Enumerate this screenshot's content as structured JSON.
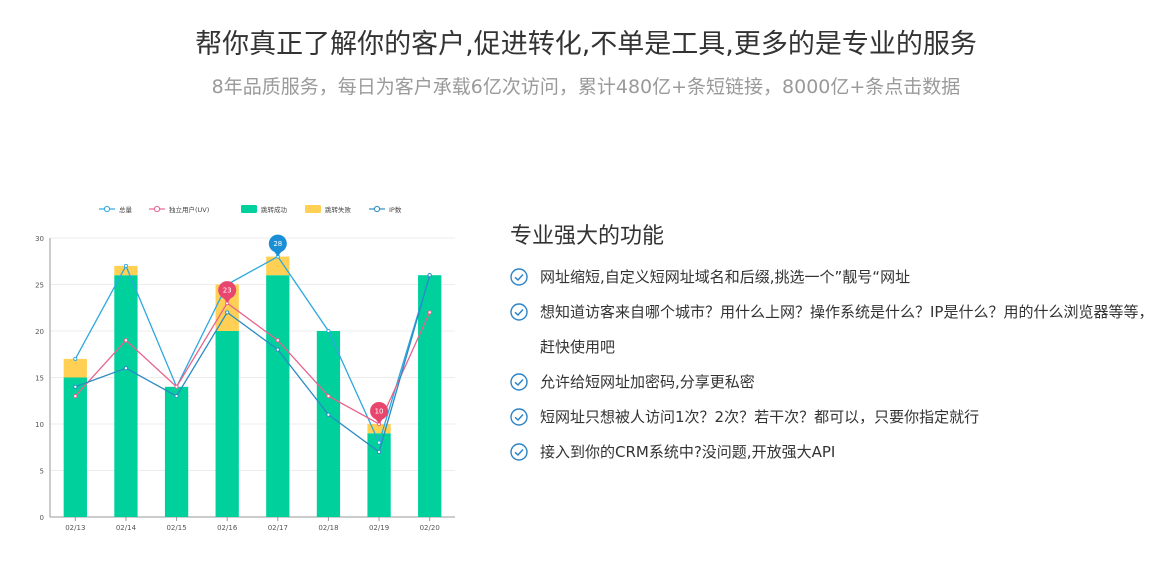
{
  "header": {
    "title": "帮你真正了解你的客户,促进转化,不单是工具,更多的是专业的服务",
    "subtitle": "8年品质服务，每日为客户承载6亿次访问，累计480亿+条短链接，8000亿+条点击数据"
  },
  "features": {
    "title": "专业强大的功能",
    "items": [
      "网址缩短,自定义短网址域名和后缀,挑选一个”靓号“网址",
      "想知道访客来自哪个城市？用什么上网？操作系统是什么？IP是什么？用的什么浏览器等等，赶快使用吧",
      "允许给短网址加密码,分享更私密",
      "短网址只想被人访问1次？2次？若干次？都可以，只要你指定就行",
      "接入到你的CRM系统中?没问题,开放强大API"
    ],
    "check_color": "#2c84c8"
  },
  "chart_data": {
    "type": "bar",
    "categories": [
      "02/13",
      "02/14",
      "02/15",
      "02/16",
      "02/17",
      "02/18",
      "02/19",
      "02/20"
    ],
    "ylim": [
      0,
      30
    ],
    "yticks": [
      0,
      5,
      10,
      15,
      20,
      25,
      30
    ],
    "legend_position": "top-center",
    "grid": true,
    "series": [
      {
        "name": "总量",
        "kind": "line",
        "color": "#2ea8e0",
        "values": [
          17,
          27,
          14,
          25,
          28,
          20,
          8,
          26
        ]
      },
      {
        "name": "独立用户(UV)",
        "kind": "line",
        "color": "#e8638d",
        "values": [
          13,
          19,
          14,
          23,
          19,
          13,
          10,
          22
        ]
      },
      {
        "name": "跳转成功",
        "kind": "bar",
        "stack": "a",
        "color": "#00d09c",
        "values": [
          15,
          26,
          14,
          20,
          26,
          20,
          9,
          26
        ]
      },
      {
        "name": "跳转失败",
        "kind": "bar",
        "stack": "a",
        "color": "#ffd054",
        "values": [
          2,
          1,
          0,
          5,
          2,
          0,
          1,
          0
        ]
      },
      {
        "name": "IP数",
        "kind": "line",
        "color": "#2a8bc4",
        "values": [
          14,
          16,
          13,
          22,
          18,
          11,
          7,
          26
        ]
      }
    ],
    "markers": [
      {
        "series": "独立用户(UV)",
        "category": "02/16",
        "label": "23",
        "color": "#e8466e"
      },
      {
        "series": "总量",
        "category": "02/17",
        "label": "28",
        "color": "#1b8fd6"
      },
      {
        "series": "独立用户(UV)",
        "category": "02/19",
        "label": "10",
        "color": "#e8466e"
      }
    ]
  }
}
